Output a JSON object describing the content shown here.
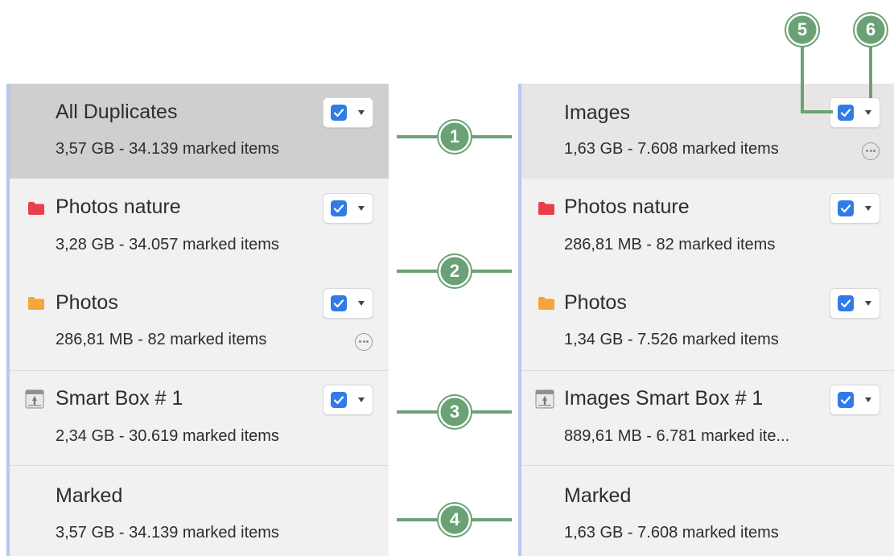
{
  "colors": {
    "panel_bg": "#f1f1f1",
    "selection_bar": "#b4c8f2",
    "selected_left_row": "#cfcfcf",
    "selected_right_row": "#e7e6e4",
    "checkbox_blue": "#2f7ce8",
    "callout_green": "#6aa276",
    "folder_red": "#e8404a",
    "folder_orange": "#f6a53a"
  },
  "left_list": {
    "rows": [
      {
        "title": "All Duplicates",
        "subtitle": "3,57 GB - 34.139 marked items",
        "checked": true,
        "icon": "none"
      },
      {
        "title": "Photos nature",
        "subtitle": "3,28 GB - 34.057 marked items",
        "checked": true,
        "icon": "red-folder-icon"
      },
      {
        "title": "Photos",
        "subtitle": "286,81 MB - 82 marked items",
        "checked": true,
        "icon": "orange-folder-icon",
        "more_icon": "ellipsis-circle-icon"
      },
      {
        "title": "Smart Box # 1",
        "subtitle": "2,34 GB - 30.619 marked items",
        "checked": true,
        "icon": "smart-box-icon"
      },
      {
        "title": "Marked",
        "subtitle": "3,57 GB - 34.139 marked items",
        "checked": false,
        "icon": "none"
      }
    ]
  },
  "right_list": {
    "rows": [
      {
        "title": "Images",
        "subtitle": "1,63 GB - 7.608 marked items",
        "checked": true,
        "icon": "none",
        "more_icon": "ellipsis-circle-icon"
      },
      {
        "title": "Photos nature",
        "subtitle": "286,81 MB - 82 marked items",
        "checked": true,
        "icon": "red-folder-icon"
      },
      {
        "title": "Photos",
        "subtitle": "1,34 GB - 7.526 marked items",
        "checked": true,
        "icon": "orange-folder-icon"
      },
      {
        "title": "Images Smart Box # 1",
        "subtitle": "889,61 MB - 6.781 marked ite...",
        "checked": true,
        "icon": "smart-box-icon"
      },
      {
        "title": "Marked",
        "subtitle": "1,63 GB - 7.608 marked items",
        "checked": false,
        "icon": "none"
      }
    ]
  },
  "callouts": [
    "1",
    "2",
    "3",
    "4",
    "5",
    "6"
  ]
}
